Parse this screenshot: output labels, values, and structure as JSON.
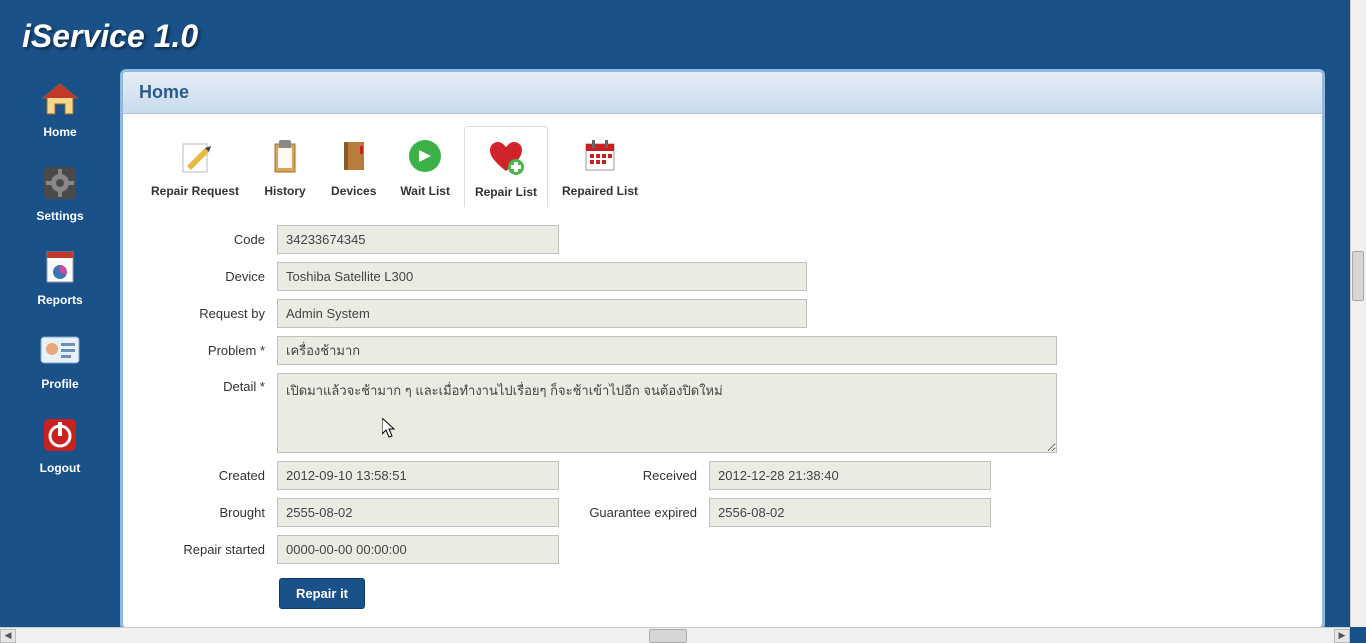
{
  "app": {
    "title": "iService 1.0"
  },
  "sidebar": {
    "items": [
      {
        "label": "Home"
      },
      {
        "label": "Settings"
      },
      {
        "label": "Reports"
      },
      {
        "label": "Profile"
      },
      {
        "label": "Logout"
      }
    ]
  },
  "panel": {
    "title": "Home"
  },
  "toolbar": {
    "items": [
      {
        "label": "Repair Request"
      },
      {
        "label": "History"
      },
      {
        "label": "Devices"
      },
      {
        "label": "Wait List"
      },
      {
        "label": "Repair List"
      },
      {
        "label": "Repaired List"
      }
    ]
  },
  "form": {
    "labels": {
      "code": "Code",
      "device": "Device",
      "request_by": "Request by",
      "problem": "Problem *",
      "detail": "Detail *",
      "created": "Created",
      "received": "Received",
      "brought": "Brought",
      "guarantee": "Guarantee expired",
      "repair_started": "Repair started"
    },
    "values": {
      "code": "34233674345",
      "device": "Toshiba Satellite L300",
      "request_by": "Admin System",
      "problem": "เครื่องช้ามาก",
      "detail": "เปิดมาแล้วจะช้ามาก ๆ และเมื่อทำงานไปเรื่อยๆ ก็จะช้าเข้าไปอีก จนต้องปิดใหม่",
      "created": "2012-09-10 13:58:51",
      "received": "2012-12-28 21:38:40",
      "brought": "2555-08-02",
      "guarantee": "2556-08-02",
      "repair_started": "0000-00-00 00:00:00"
    },
    "button": "Repair it"
  }
}
